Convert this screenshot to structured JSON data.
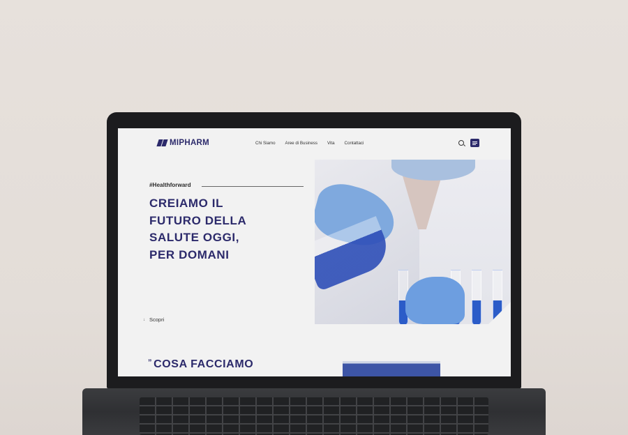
{
  "brand": {
    "name": "MIPHARM"
  },
  "nav": {
    "items": [
      {
        "label": "Chi Siamo"
      },
      {
        "label": "Aree di Business"
      },
      {
        "label": "Vita"
      },
      {
        "label": "Contattaci"
      }
    ],
    "icons": [
      "search-icon",
      "menu-icon"
    ]
  },
  "hero": {
    "hashtag": "#Healthforward",
    "title_lines": [
      "CREIAMO IL",
      "FUTURO DELLA",
      "SALUTE OGGI,",
      "PER DOMANI"
    ],
    "scroll_label": "Scopri",
    "scroll_icon": "arrow-down-icon"
  },
  "section": {
    "title": "COSA FACCIAMO",
    "icon": "quote-icon"
  },
  "colors": {
    "brand": "#2c2a6b",
    "background": "#f2f2f2",
    "accent_blue": "#2f4fb8"
  }
}
